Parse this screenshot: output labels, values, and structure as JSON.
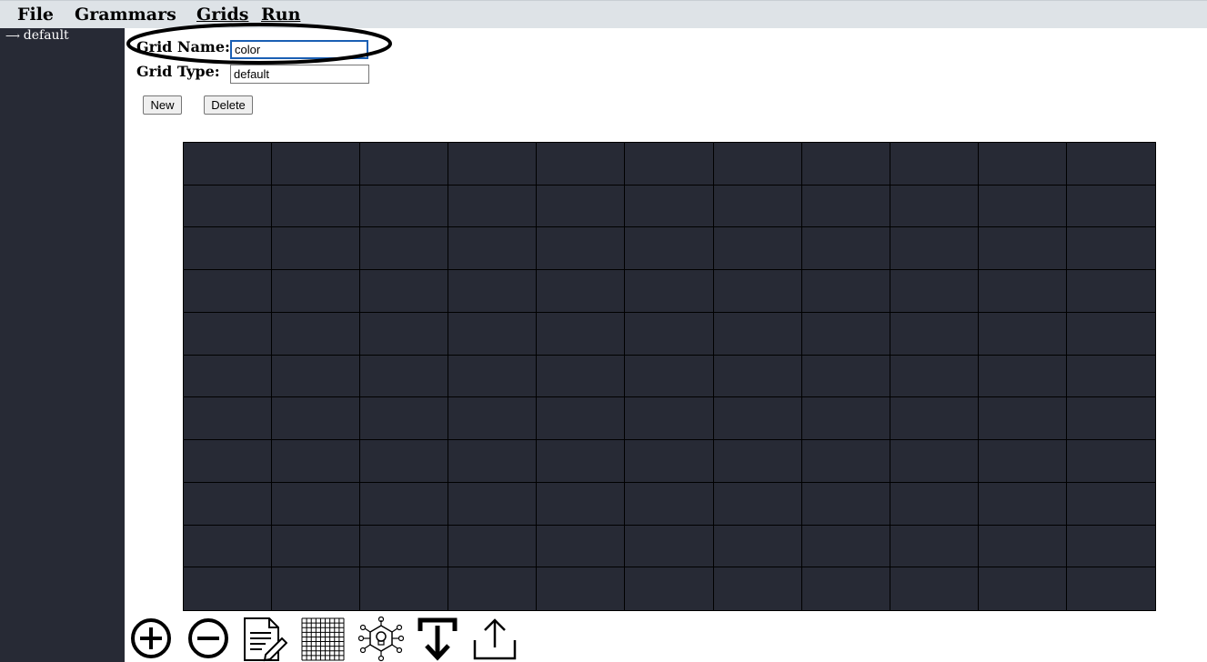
{
  "menu": {
    "file": "File",
    "grammars": "Grammars",
    "grids": "Grids",
    "run": "Run"
  },
  "sidebar": {
    "items": [
      {
        "arrow": "⟶",
        "label": "default"
      }
    ]
  },
  "form": {
    "grid_name_label": "Grid Name:",
    "grid_name_value": "color",
    "grid_type_label": "Grid Type:",
    "grid_type_value": "default",
    "new_label": "New",
    "delete_label": "Delete"
  },
  "grid": {
    "rows": 11,
    "columns": 11,
    "cell_color": "#272a35",
    "line_color": "#000000"
  },
  "toolbar": {
    "icons": [
      "add-circle-icon",
      "remove-circle-icon",
      "edit-document-icon",
      "grid-icon",
      "network-bulb-icon",
      "download-icon",
      "upload-icon"
    ]
  },
  "colors": {
    "menubar": "#dee3e7",
    "sidebar": "#272a35",
    "focus": "#1a5fb4"
  }
}
